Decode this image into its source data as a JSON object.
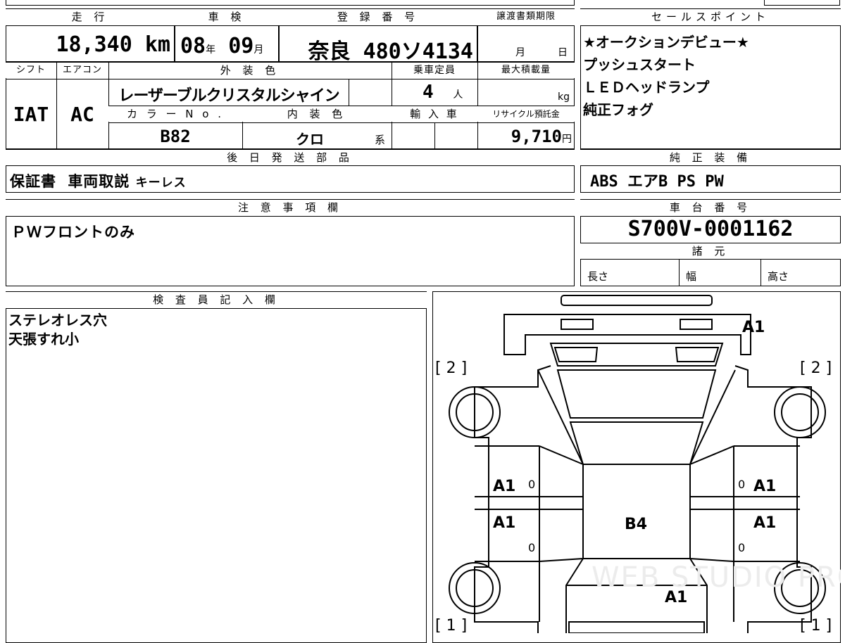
{
  "headers": {
    "mileage": "走 行",
    "inspection": "車 検",
    "registration": "登 録 番 号",
    "transfer_deadline": "譲渡書類期限",
    "sales_points": "セールスポイント",
    "shift": "シフト",
    "ac": "エアコン",
    "exterior_color": "外 装 色",
    "capacity": "乗車定員",
    "max_load": "最大積載量",
    "color_no": "カ ラ ー N o .",
    "interior_color": "内 装 色",
    "import": "輸 入 車",
    "recycle_fee": "リサイクル預託金",
    "later_parts": "後 日 発 送 部 品",
    "standard_equipment": "純 正 装 備",
    "notes": "注 意 事 項 欄",
    "chassis_number": "車 台 番 号",
    "specs": "諸 元",
    "inspector_notes": "検 査 員 記 入 欄"
  },
  "mileage": {
    "value": "18,340",
    "unit": "km"
  },
  "inspection": {
    "year": "08",
    "year_unit": "年",
    "month": "09",
    "month_unit": "月"
  },
  "registration": {
    "area": "奈良",
    "class": "480",
    "kana": "ソ",
    "number": "4134"
  },
  "transfer": {
    "month": "月",
    "day": "日"
  },
  "shift": "IAT",
  "ac": "AC",
  "exterior_color": "レーザーブルクリスタルシャイン",
  "capacity": {
    "value": "4",
    "unit": "人"
  },
  "max_load": {
    "unit": "kg"
  },
  "color_no": "B82",
  "interior_color": {
    "value": "クロ",
    "suffix": "系"
  },
  "recycle_fee": {
    "value": "9,710",
    "unit": "円"
  },
  "sales_points": [
    "★オークションデビュー★",
    "プッシュスタート",
    "ＬＥＤヘッドランプ",
    "純正フォグ"
  ],
  "later_parts": [
    "保証書",
    "車両取説",
    "キーレス"
  ],
  "standard_equipment": "ABS エアB PS PW",
  "notes": "ＰＷフロントのみ",
  "chassis_number": "S700V-0001162",
  "specs": {
    "length": "長さ",
    "width": "幅",
    "height": "高さ"
  },
  "inspector_notes": [
    "ステレオレス穴",
    "天張すれ小"
  ],
  "diagram": {
    "marks": {
      "front_top": "A1",
      "left_front_door": "A1",
      "left_rear_door": "A1",
      "right_front_door": "A1",
      "right_rear_door": "A1",
      "roof": "B4",
      "rear": "A1"
    },
    "corner_labels": {
      "front_left": "[ 2 ]",
      "front_right": "[ 2 ]",
      "rear_left": "[ 1 ]",
      "rear_right": "[ 1 ]"
    },
    "zero": "0",
    "watermark": "WEB STUDIO PRO"
  }
}
